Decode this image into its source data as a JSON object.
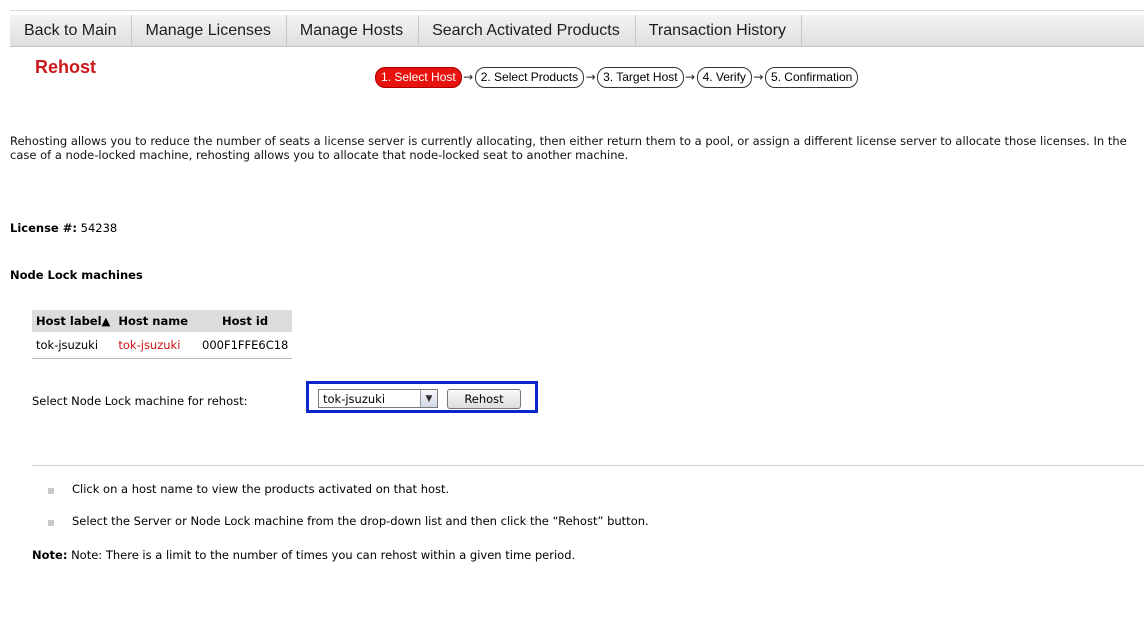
{
  "nav": {
    "tabs": [
      "Back to Main",
      "Manage Licenses",
      "Manage Hosts",
      "Search Activated Products",
      "Transaction History"
    ]
  },
  "page": {
    "title": "Rehost"
  },
  "steps": [
    "1. Select Host",
    "2. Select Products",
    "3. Target Host",
    "4. Verify",
    "5. Confirmation"
  ],
  "intro_text": "Rehosting allows you to reduce the number of seats a license server is currently allocating, then either return them to a pool, or assign a different license server to allocate those licenses. In the case of a node-locked machine, rehosting allows you to allocate that node-locked seat to another machine.",
  "license": {
    "label": "License #:",
    "number": "54238"
  },
  "node_lock": {
    "section_title": "Node Lock machines",
    "table": {
      "headers": [
        "Host label▲",
        "Host name",
        "Host id"
      ],
      "rows": [
        {
          "label": "tok-jsuzuki",
          "name": "tok-jsuzuki",
          "id": "000F1FFE6C18"
        }
      ]
    }
  },
  "rehost_form": {
    "label": "Select Node Lock machine for rehost:",
    "selected": "tok-jsuzuki",
    "button": "Rehost"
  },
  "help": [
    "Click on a host name to view the products activated on that host.",
    "Select the Server or Node Lock machine from the drop-down list and then click the “Rehost” button."
  ],
  "note": {
    "label": "Note:",
    "text": "Note: There is a limit to the number of times you can rehost within a given time period."
  },
  "colors": {
    "title_red": "#cc1a1a",
    "active_step": "#e8120f",
    "highlight": "#0a27c9"
  }
}
